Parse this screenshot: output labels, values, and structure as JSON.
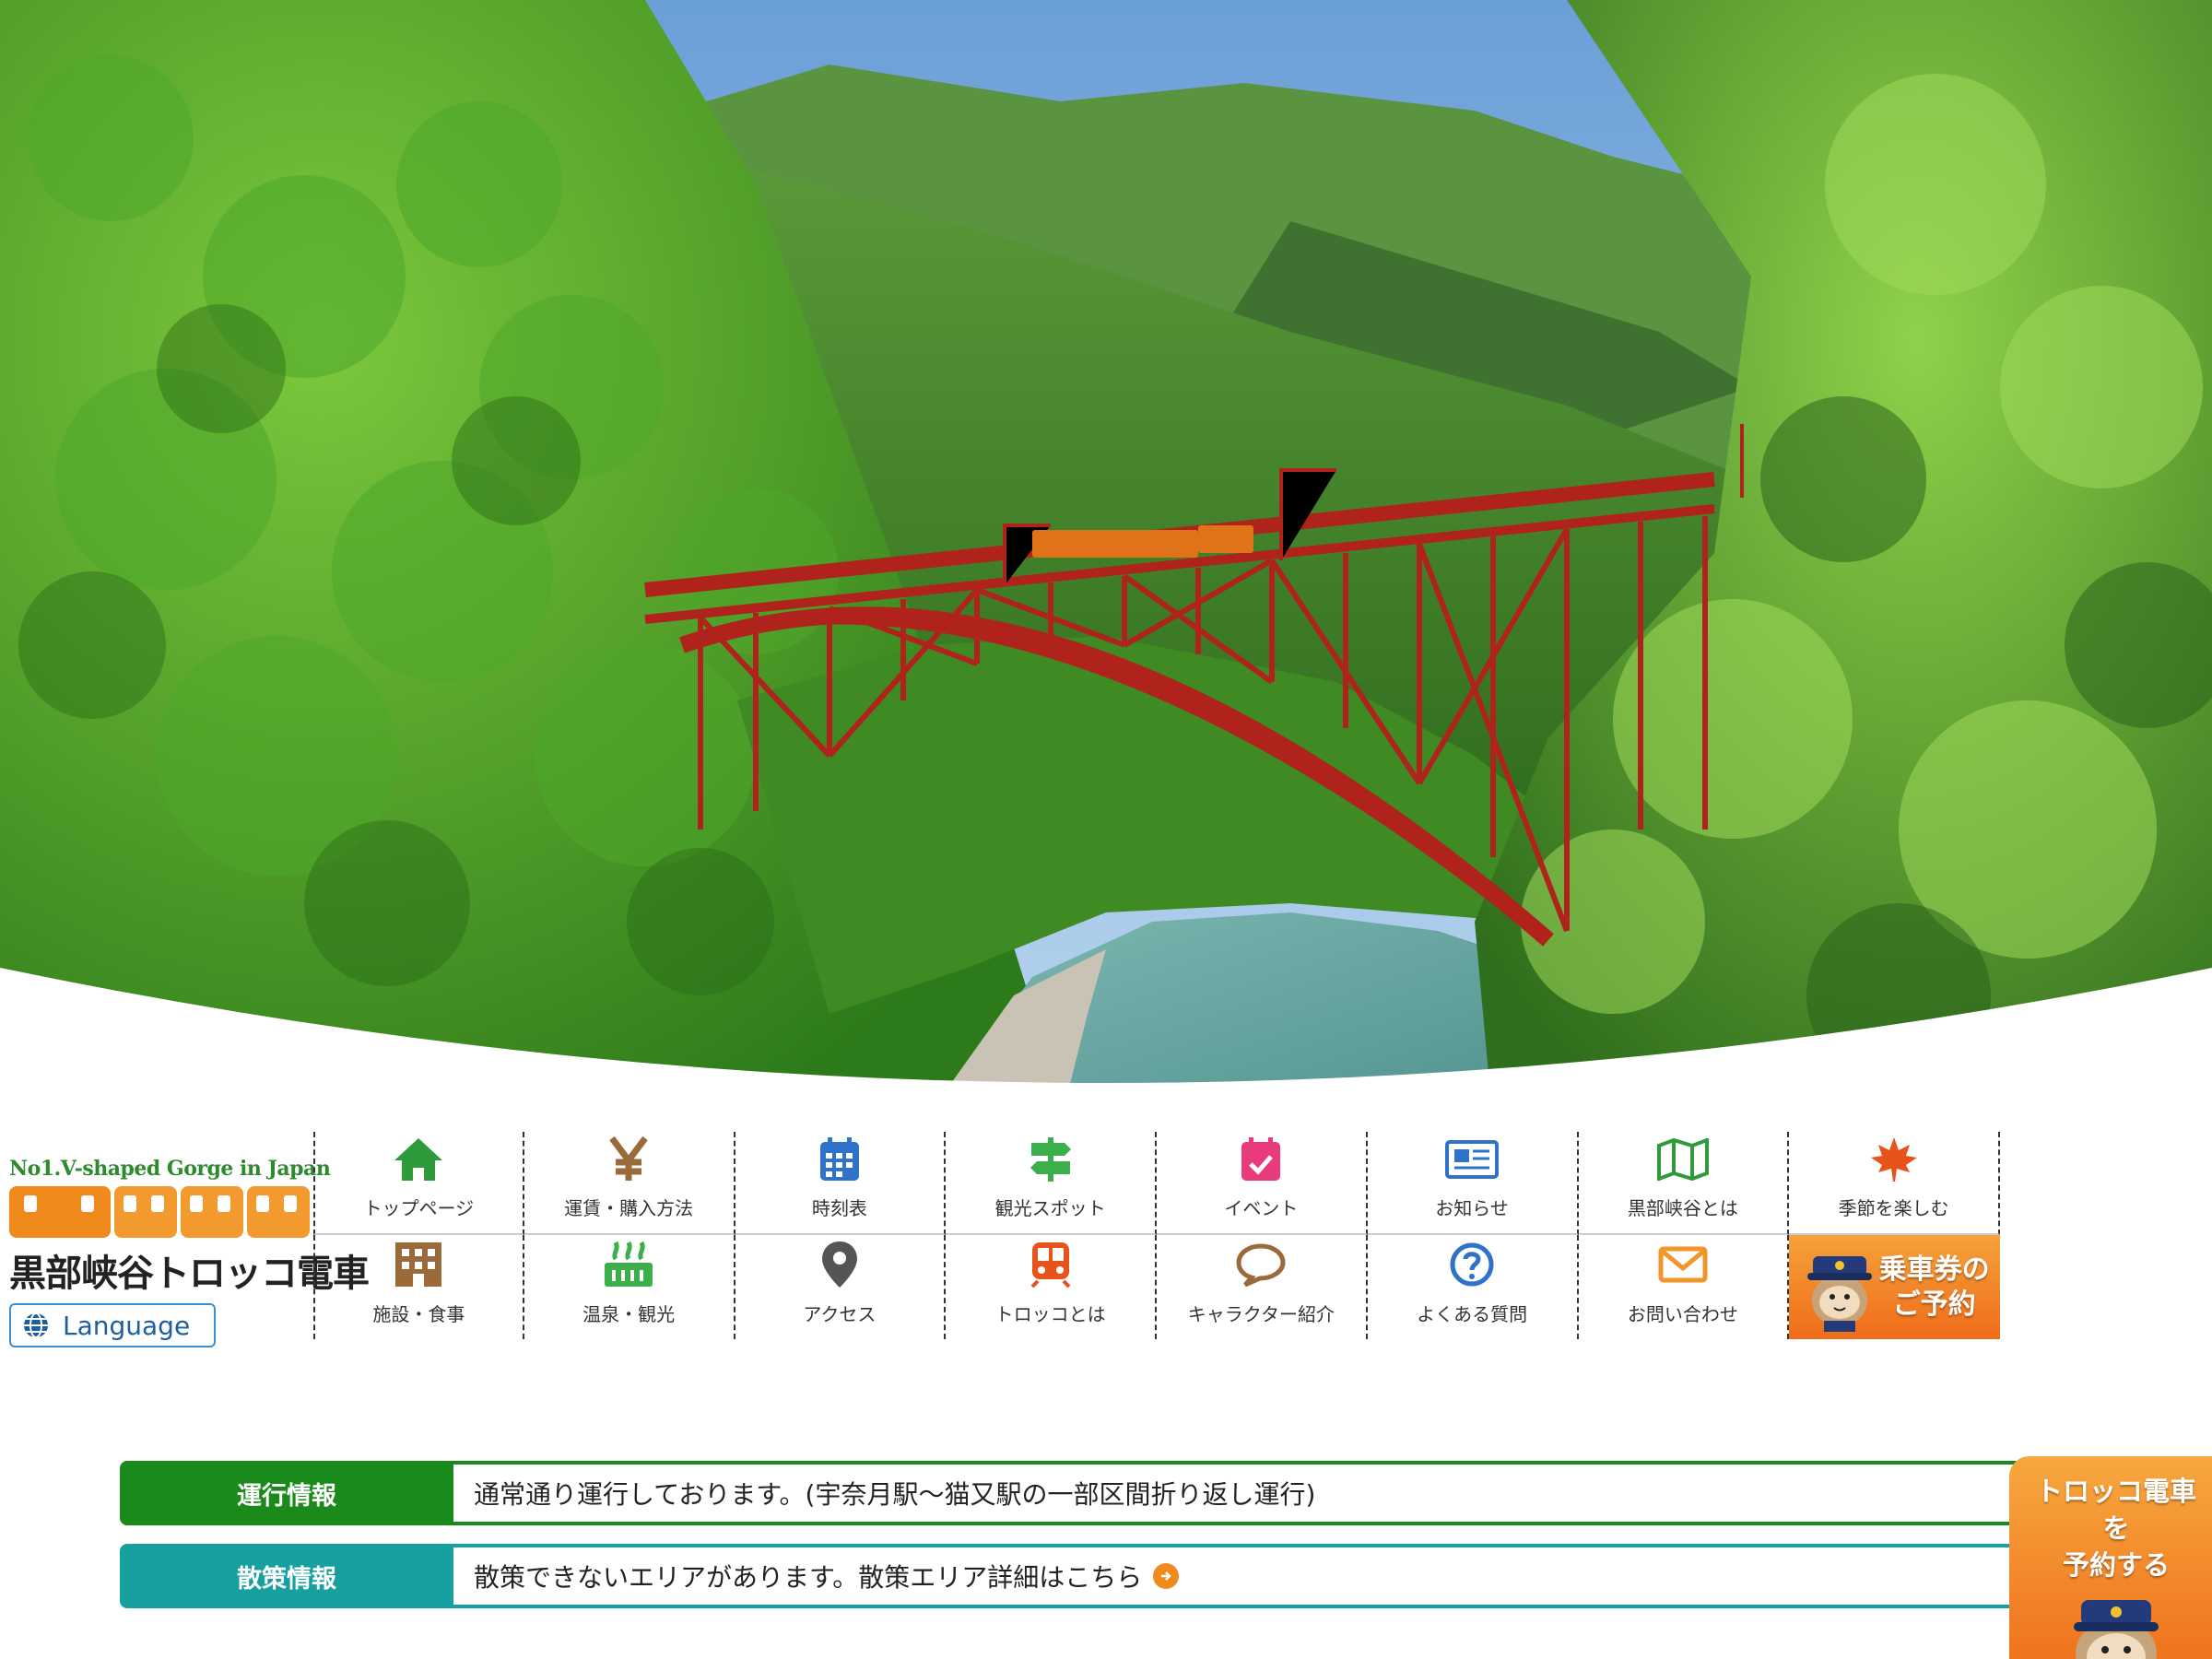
{
  "hero": {
    "alt": "Kurobe gorge red arch bridge",
    "icon": "hero-image"
  },
  "logo": {
    "tagline": "No1.V-shaped Gorge in Japan",
    "title": "黒部峡谷トロッコ電車"
  },
  "language": {
    "label": "Language",
    "icon": "globe-icon"
  },
  "nav": {
    "items": [
      {
        "label": "トップページ",
        "icon": "home-icon",
        "color": "#2e9a3a"
      },
      {
        "label": "運賃・購入方法",
        "icon": "yen-icon",
        "color": "#9a6a3a"
      },
      {
        "label": "時刻表",
        "icon": "calendar-icon",
        "color": "#2f73c9"
      },
      {
        "label": "観光スポット",
        "icon": "signpost-icon",
        "color": "#3cae4a"
      },
      {
        "label": "イベント",
        "icon": "event-calendar-icon",
        "color": "#e83a7d"
      },
      {
        "label": "お知らせ",
        "icon": "newspaper-icon",
        "color": "#2f73c9"
      },
      {
        "label": "黒部峡谷とは",
        "icon": "map-icon",
        "color": "#2e9a3a"
      },
      {
        "label": "季節を楽しむ",
        "icon": "maple-leaf-icon",
        "color": "#e8531b"
      },
      {
        "label": "施設・食事",
        "icon": "building-icon",
        "color": "#9a6a3a"
      },
      {
        "label": "温泉・観光",
        "icon": "hot-spring-icon",
        "color": "#3cae4a"
      },
      {
        "label": "アクセス",
        "icon": "location-pin-icon",
        "color": "#555555"
      },
      {
        "label": "トロッコとは",
        "icon": "train-icon",
        "color": "#e8531b"
      },
      {
        "label": "キャラクター紹介",
        "icon": "speech-bubble-icon",
        "color": "#9a6a3a"
      },
      {
        "label": "よくある質問",
        "icon": "question-icon",
        "color": "#2f73c9"
      },
      {
        "label": "お問い合わせ",
        "icon": "mail-icon",
        "color": "#f0962a"
      }
    ],
    "reserve": {
      "line1": "乗車券の",
      "line2": "ご予約"
    }
  },
  "info": {
    "operation": {
      "tag": "運行情報",
      "message": "通常通り運行しております。(宇奈月駅〜猫又駅の一部区間折り返し運行)",
      "color": "#1a8b1a"
    },
    "walk": {
      "tag": "散策情報",
      "message": "散策できないエリアがあります。散策エリア詳細はこちら",
      "color": "#17a0a0"
    }
  },
  "float_reserve": {
    "line1": "トロッコ電車を",
    "line2": "予約する"
  }
}
